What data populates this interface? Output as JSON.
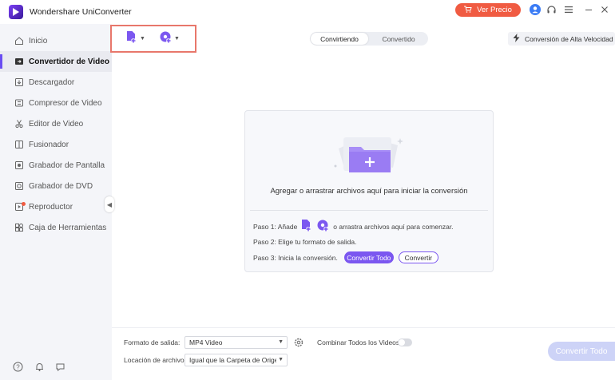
{
  "app": {
    "title": "Wondershare UniConverter"
  },
  "titlebar": {
    "price_label": "Ver Precio"
  },
  "sidebar": {
    "items": [
      {
        "label": "Inicio",
        "icon": "home-icon"
      },
      {
        "label": "Convertidor de Video",
        "icon": "convert-icon",
        "active": true
      },
      {
        "label": "Descargador",
        "icon": "download-icon"
      },
      {
        "label": "Compresor de Video",
        "icon": "compress-icon"
      },
      {
        "label": "Editor de Video",
        "icon": "scissors-icon"
      },
      {
        "label": "Fusionador",
        "icon": "merge-icon"
      },
      {
        "label": "Grabador de Pantalla",
        "icon": "screen-record-icon"
      },
      {
        "label": "Grabador de DVD",
        "icon": "dvd-icon"
      },
      {
        "label": "Reproductor",
        "icon": "play-icon",
        "badge_dot": true
      },
      {
        "label": "Caja de Herramientas",
        "icon": "toolbox-icon"
      }
    ]
  },
  "tabs": {
    "converting": "Convirtiendo",
    "converted": "Convertido"
  },
  "speed_label": "Conversión de Alta Velocidad",
  "dropzone": {
    "prompt": "Agregar o arrastrar archivos aquí para iniciar la conversión",
    "step1_prefix": "Paso 1: Añade",
    "step1_suffix": "o arrastra archivos aquí para comenzar.",
    "step2": "Paso 2: Elige tu formato de salida.",
    "step3": "Paso 3: Inicia la conversión.",
    "convert_all_label": "Convertir Todo",
    "convert_label": "Convertir"
  },
  "bottom": {
    "output_format_label": "Formato de salida:",
    "output_format_value": "MP4 Video",
    "merge_label": "Combinar Todos los Videos",
    "location_label": "Locación de archivo:",
    "location_value": "Igual que la Carpeta de Origen",
    "convert_all_button": "Convertir Todo"
  },
  "colors": {
    "accent": "#7b57f0",
    "price": "#f05b42",
    "highlight_box": "#e8776b"
  }
}
